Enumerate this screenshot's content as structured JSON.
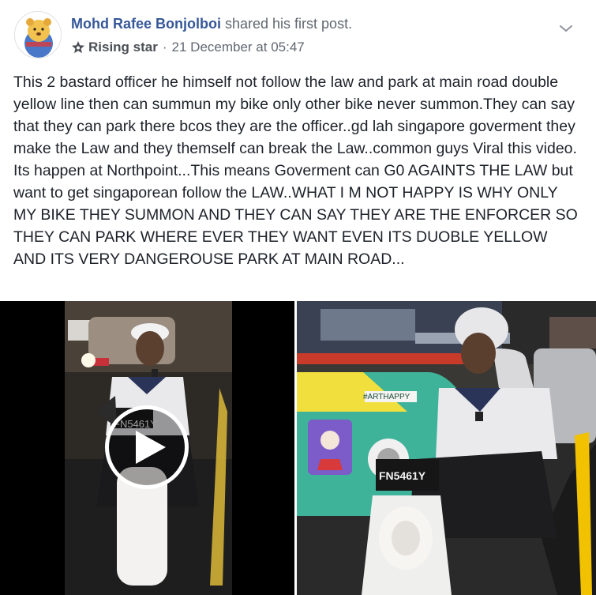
{
  "post": {
    "author": "Mohd Rafee Bonjolboi",
    "action": "shared his first post.",
    "badge": "Rising star",
    "separator": "·",
    "timestamp": "21 December at 05:47",
    "text": "This 2 bastard officer he himself not follow the law and park at main road double yellow line then can summun my bike only other bike never summon.They can say that they can park there bcos they are the officer..gd lah singapore goverment they make the Law and they themself can break the Law..common guys Viral this video. Its happen at Northpoint...This means Goverment can G0 AGAINTS THE LAW but want to get singaporean follow the LAW..WHAT I M NOT HAPPY IS WHY ONLY MY BIKE THEY SUMMON AND THEY CAN SAY THEY ARE THE ENFORCER SO THEY CAN PARK WHERE EVER THEY WANT EVEN ITS DUOBLE YELLOW AND ITS VERY DANGEROUSE PARK AT MAIN ROAD...",
    "plate_video": "FN5461Y",
    "plate_photo": "FN5461Y",
    "photo_decal": "#ARTHAPPY"
  },
  "icons": {
    "badge": "star-badge-icon",
    "menu": "chevron-down-icon",
    "play": "play-icon"
  },
  "colors": {
    "author": "#365899",
    "meta": "#616770",
    "text": "#1d2129",
    "taxi": "#3fb39a",
    "road_line": "#f2c200"
  }
}
